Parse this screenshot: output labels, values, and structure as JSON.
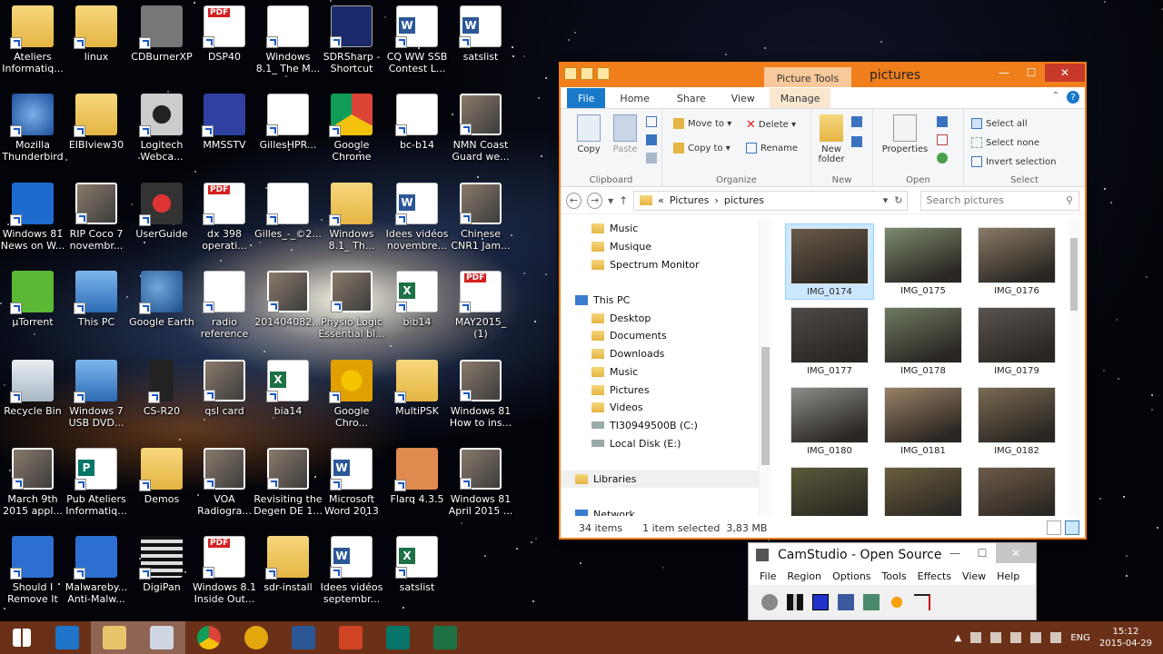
{
  "desktop": {
    "icons": [
      {
        "label": "Ateliers\nInformatiq...",
        "icon": "folder-people-icon"
      },
      {
        "label": "linux",
        "icon": "linux-folder-icon"
      },
      {
        "label": "CDBurnerXP",
        "icon": "cd-burner-icon"
      },
      {
        "label": "DSP40",
        "icon": "pdf-icon"
      },
      {
        "label": "Windows\n8.1_ The M...",
        "icon": "document-icon"
      },
      {
        "label": "SDRSharp -\nShortcut",
        "icon": "sdr-icon"
      },
      {
        "label": "CQ WW SSB\nContest L...",
        "icon": "word-icon"
      },
      {
        "label": "satslist",
        "icon": "word-icon"
      },
      {
        "label": "Mozilla\nThunderbird",
        "icon": "thunderbird-icon"
      },
      {
        "label": "EIBIview30",
        "icon": "folder-icon"
      },
      {
        "label": "Logitech\nWebca...",
        "icon": "webcam-icon"
      },
      {
        "label": "MMSSTV",
        "icon": "sstv-icon"
      },
      {
        "label": "GillesHPR...",
        "icon": "document-icon"
      },
      {
        "label": "Google\nChrome",
        "icon": "chrome-icon"
      },
      {
        "label": "bc-b14",
        "icon": "text-doc-icon"
      },
      {
        "label": "NMN Coast\nGuard we...",
        "icon": "media-icon"
      },
      {
        "label": "Windows 81\nNews on W...",
        "icon": "windows-news-icon"
      },
      {
        "label": "RIP Coco 7\nnovembr...",
        "icon": "photo-icon"
      },
      {
        "label": "UserGuide",
        "icon": "compass-icon"
      },
      {
        "label": "dx 398\noperati...",
        "icon": "pdf-icon"
      },
      {
        "label": "Gilles_-_©2...",
        "icon": "document-icon"
      },
      {
        "label": "Windows\n8.1_ Th...",
        "icon": "folder-icon"
      },
      {
        "label": "Idees vidéos\nnovembre...",
        "icon": "word-icon"
      },
      {
        "label": "Chinese\nCNR1 Jam...",
        "icon": "media-icon"
      },
      {
        "label": "µTorrent",
        "icon": "utorrent-icon"
      },
      {
        "label": "This PC",
        "icon": "computer-icon"
      },
      {
        "label": "Google Earth",
        "icon": "google-earth-icon"
      },
      {
        "label": "radio\nreference",
        "icon": "text-doc-icon"
      },
      {
        "label": "201404082...",
        "icon": "photo-icon"
      },
      {
        "label": "Physio Logic\nEssential bl...",
        "icon": "media-icon"
      },
      {
        "label": "bib14",
        "icon": "excel-icon"
      },
      {
        "label": "MAY2015_\n(1)",
        "icon": "pdf-icon"
      },
      {
        "label": "Recycle Bin",
        "icon": "recycle-bin-icon"
      },
      {
        "label": "Windows 7\nUSB DVD...",
        "icon": "usb-dvd-icon"
      },
      {
        "label": "CS-R20",
        "icon": "radio-icon"
      },
      {
        "label": "qsl card",
        "icon": "photo-icon"
      },
      {
        "label": "bia14",
        "icon": "excel-icon"
      },
      {
        "label": "Google\nChro...",
        "icon": "chrome-canary-icon"
      },
      {
        "label": "MultiPSK",
        "icon": "folder-icon"
      },
      {
        "label": "Windows 81\nHow to ins...",
        "icon": "media-icon"
      },
      {
        "label": "March 9th\n2015 appl...",
        "icon": "media-icon"
      },
      {
        "label": "Pub Ateliers\nInformatiq...",
        "icon": "publisher-icon"
      },
      {
        "label": "Demos",
        "icon": "folder-icon"
      },
      {
        "label": "VOA\nRadiogra...",
        "icon": "image-grid-icon"
      },
      {
        "label": "Revisiting the\nDegen DE 1...",
        "icon": "media-icon"
      },
      {
        "label": "Microsoft\nWord 2013",
        "icon": "word-app-icon"
      },
      {
        "label": "Flarq 4.3.5",
        "icon": "handshake-icon"
      },
      {
        "label": "Windows 81\nApril 2015 ...",
        "icon": "media-icon"
      },
      {
        "label": "Should I\nRemove It",
        "icon": "should-i-remove-icon"
      },
      {
        "label": "Malwareby...\nAnti-Malw...",
        "icon": "malwarebytes-icon"
      },
      {
        "label": "DigiPan",
        "icon": "digipan-icon"
      },
      {
        "label": "Windows 8.1\nInside Out...",
        "icon": "pdf-icon"
      },
      {
        "label": "sdr-install",
        "icon": "folder-icon"
      },
      {
        "label": "Idees vidéos\nseptembr...",
        "icon": "word-icon"
      },
      {
        "label": "satslist",
        "icon": "excel-icon"
      }
    ]
  },
  "explorer": {
    "context_tab": "Picture Tools",
    "title": "pictures",
    "tabs": [
      "File",
      "Home",
      "Share",
      "View",
      "Manage"
    ],
    "ribbon": {
      "clipboard": {
        "copy": "Copy",
        "paste": "Paste",
        "label": "Clipboard"
      },
      "organize": {
        "move_to": "Move to",
        "copy_to": "Copy to",
        "delete": "Delete",
        "rename": "Rename",
        "label": "Organize"
      },
      "new": {
        "new_folder": "New\nfolder",
        "label": "New"
      },
      "open": {
        "properties": "Properties",
        "label": "Open"
      },
      "select": {
        "select_all": "Select all",
        "select_none": "Select none",
        "invert": "Invert selection",
        "label": "Select"
      }
    },
    "address": {
      "prefix": "«",
      "crumb1": "Pictures",
      "sep": "›",
      "crumb2": "pictures"
    },
    "search_placeholder": "Search pictures",
    "nav_items": [
      {
        "label": "Music",
        "type": "folder",
        "indent": 1
      },
      {
        "label": "Musique",
        "type": "folder",
        "indent": 1
      },
      {
        "label": "Spectrum Monitor",
        "type": "folder",
        "indent": 1
      },
      {
        "label": "",
        "type": "spacer",
        "indent": 0
      },
      {
        "label": "This PC",
        "type": "pc",
        "indent": 0
      },
      {
        "label": "Desktop",
        "type": "folder",
        "indent": 1
      },
      {
        "label": "Documents",
        "type": "folder",
        "indent": 1
      },
      {
        "label": "Downloads",
        "type": "folder",
        "indent": 1
      },
      {
        "label": "Music",
        "type": "folder",
        "indent": 1
      },
      {
        "label": "Pictures",
        "type": "folder",
        "indent": 1
      },
      {
        "label": "Videos",
        "type": "folder",
        "indent": 1
      },
      {
        "label": "TI30949500B (C:)",
        "type": "drive",
        "indent": 1
      },
      {
        "label": "Local Disk (E:)",
        "type": "drive",
        "indent": 1
      },
      {
        "label": "",
        "type": "spacer",
        "indent": 0
      },
      {
        "label": "Libraries",
        "type": "folder",
        "indent": 0
      },
      {
        "label": "",
        "type": "spacer",
        "indent": 0
      },
      {
        "label": "Network",
        "type": "pc",
        "indent": 0
      }
    ],
    "files": [
      {
        "name": "IMG_0174",
        "selected": true,
        "tone": "#6a5a4a"
      },
      {
        "name": "IMG_0175",
        "selected": false,
        "tone": "#7c8a6e"
      },
      {
        "name": "IMG_0176",
        "selected": false,
        "tone": "#8a7a66"
      },
      {
        "name": "IMG_0177",
        "selected": false,
        "tone": "#4e4a48"
      },
      {
        "name": "IMG_0178",
        "selected": false,
        "tone": "#6e7a62"
      },
      {
        "name": "IMG_0179",
        "selected": false,
        "tone": "#5a5450"
      },
      {
        "name": "IMG_0180",
        "selected": false,
        "tone": "#8c8c88"
      },
      {
        "name": "IMG_0181",
        "selected": false,
        "tone": "#9a8066"
      },
      {
        "name": "IMG_0182",
        "selected": false,
        "tone": "#7a6a52"
      },
      {
        "name": "",
        "selected": false,
        "tone": "#5a5a3a"
      },
      {
        "name": "",
        "selected": false,
        "tone": "#6a5e3e"
      },
      {
        "name": "",
        "selected": false,
        "tone": "#6e5a48"
      }
    ],
    "status": {
      "count": "34 items",
      "selection": "1 item selected  3,83 MB"
    }
  },
  "camstudio": {
    "title": "CamStudio - Open Source",
    "menu": [
      "File",
      "Region",
      "Options",
      "Tools",
      "Effects",
      "View",
      "Help"
    ]
  },
  "taskbar": {
    "apps": [
      {
        "name": "start-button",
        "color": "#6b3118"
      },
      {
        "name": "ie-taskbar",
        "color": "#1e74c9"
      },
      {
        "name": "explorer-taskbar",
        "color": "#e8c46a"
      },
      {
        "name": "window-taskbar",
        "color": "#cfd7e2"
      },
      {
        "name": "chrome-taskbar",
        "color": "#2f9e48"
      },
      {
        "name": "chrome-canary-taskbar",
        "color": "#e5a70e"
      },
      {
        "name": "word-taskbar",
        "color": "#2b5797"
      },
      {
        "name": "powerpoint-taskbar",
        "color": "#d04423"
      },
      {
        "name": "publisher-taskbar",
        "color": "#077568"
      },
      {
        "name": "excel-taskbar",
        "color": "#1e7145"
      }
    ],
    "lang": "ENG",
    "time": "15:12",
    "date": "2015-04-29"
  }
}
